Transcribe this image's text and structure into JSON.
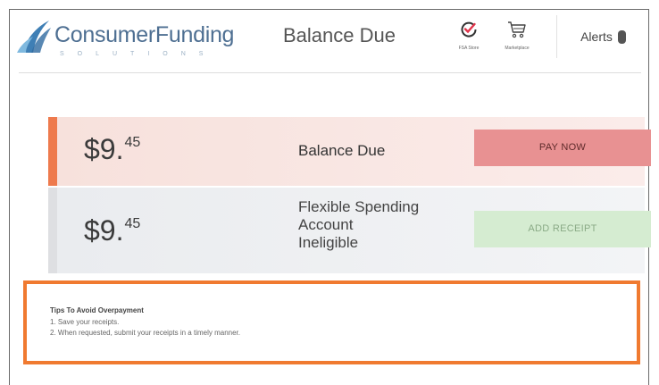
{
  "header": {
    "brand": "ConsumerFunding",
    "brand_sub": "SOLUTIONS",
    "title": "Balance Due",
    "icons": [
      {
        "name": "fsa-store-icon",
        "label": "FSA Store"
      },
      {
        "name": "marketplace-icon",
        "label": "Marketplace"
      }
    ],
    "alerts_label": "Alerts"
  },
  "cards": {
    "balance": {
      "amount_main": "$9.",
      "amount_cents": "45",
      "label": "Balance Due",
      "button": "PAY NOW"
    },
    "fsa": {
      "amount_main": "$9.",
      "amount_cents": "45",
      "label_lines": [
        "Flexible Spending",
        "Account",
        "Ineligible"
      ],
      "button": "ADD RECEIPT"
    }
  },
  "tips": {
    "title": "Tips To Avoid Overpayment",
    "items": [
      "1. Save your receipts.",
      "2. When requested, submit your receipts in a timely manner."
    ]
  },
  "colors": {
    "brand": "#4e6f92",
    "accent_orange": "#ee7a4d",
    "pay_button": "#e89192",
    "receipt_button": "#d5ecd1",
    "tips_border": "#f07a30"
  }
}
